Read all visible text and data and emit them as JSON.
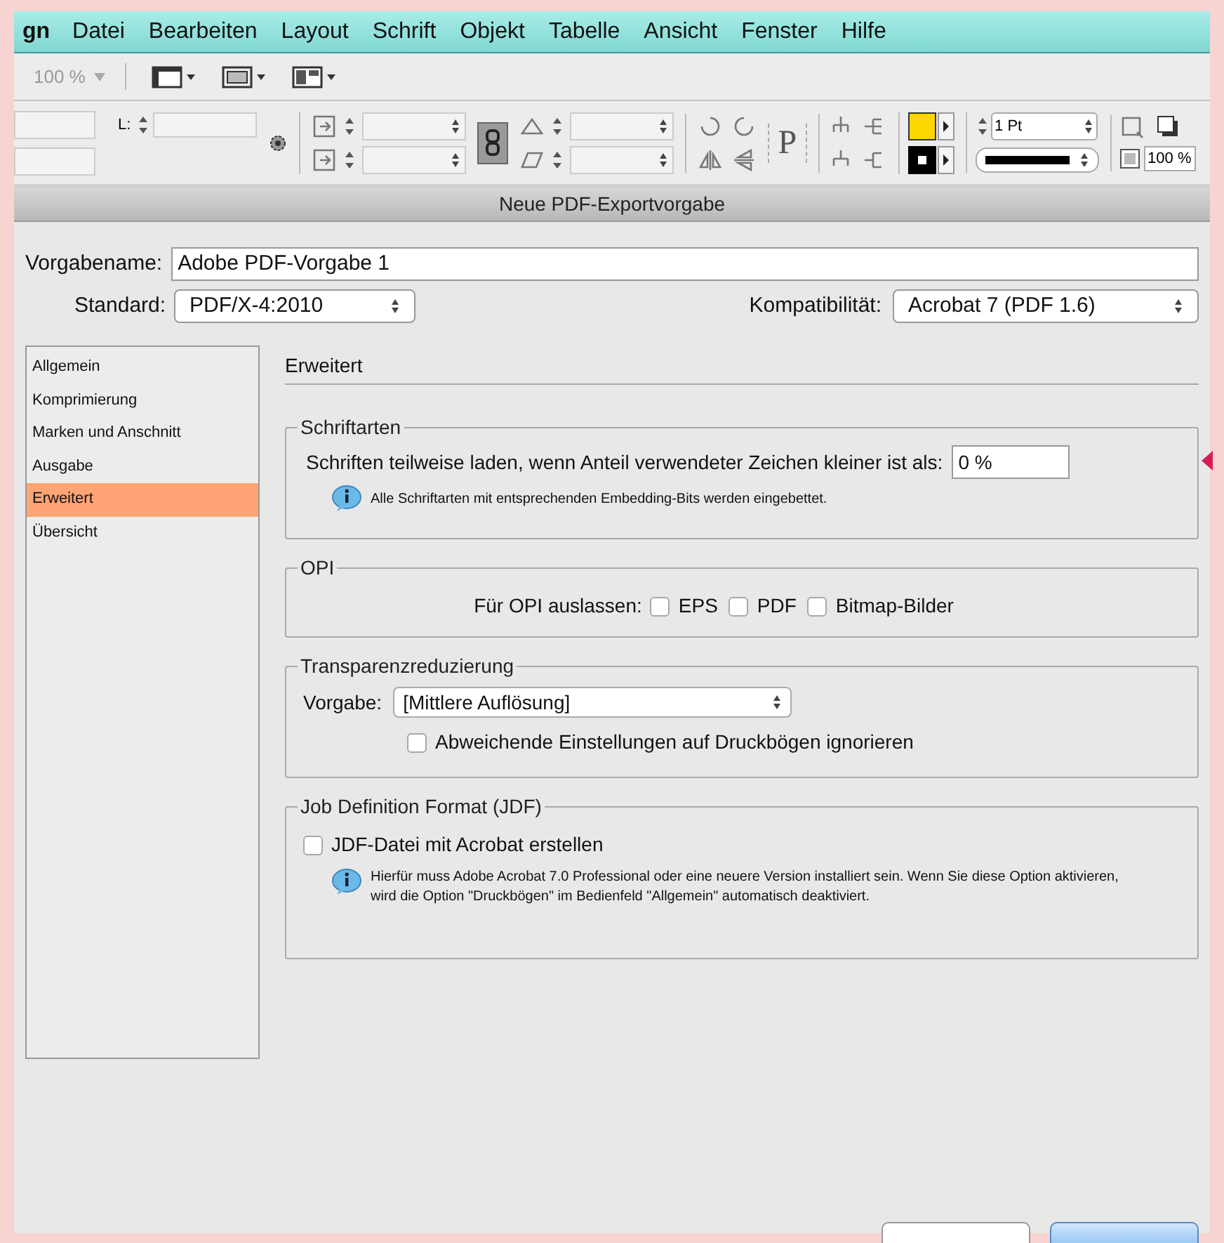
{
  "menu_bar": {
    "app_fragment": "gn",
    "items": [
      "Datei",
      "Bearbeiten",
      "Layout",
      "Schrift",
      "Objekt",
      "Tabelle",
      "Ansicht",
      "Fenster",
      "Hilfe"
    ]
  },
  "toolbar": {
    "zoom": "100 %"
  },
  "control_panel": {
    "l_label": "L:",
    "text_frame_glyph": "P",
    "stroke_weight": "1 Pt",
    "scale": "100 %"
  },
  "dialog": {
    "title": "Neue PDF-Exportvorgabe",
    "preset_name": {
      "label": "Vorgabename:",
      "value": "Adobe PDF-Vorgabe 1"
    },
    "standard": {
      "label": "Standard:",
      "value": "PDF/X-4:2010"
    },
    "compatibility": {
      "label": "Kompatibilität:",
      "value": "Acrobat 7 (PDF 1.6)"
    },
    "sidebar": {
      "items": [
        {
          "label": "Allgemein",
          "selected": false
        },
        {
          "label": "Komprimierung",
          "selected": false
        },
        {
          "label": "Marken und Anschnitt",
          "selected": false
        },
        {
          "label": "Ausgabe",
          "selected": false
        },
        {
          "label": "Erweitert",
          "selected": true
        },
        {
          "label": "Übersicht",
          "selected": false
        }
      ]
    },
    "section_title": "Erweitert",
    "fonts": {
      "title": "Schriftarten",
      "label": "Schriften teilweise laden, wenn Anteil verwendeter Zeichen kleiner ist als:",
      "value": "0 %",
      "info": "Alle Schriftarten mit entsprechenden Embedding-Bits werden eingebettet."
    },
    "opi": {
      "title": "OPI",
      "label": "Für OPI auslassen:",
      "options": [
        {
          "label": "EPS",
          "checked": false
        },
        {
          "label": "PDF",
          "checked": false
        },
        {
          "label": "Bitmap-Bilder",
          "checked": false
        }
      ]
    },
    "transparency": {
      "title": "Transparenzreduzierung",
      "preset_label": "Vorgabe:",
      "preset_value": "[Mittlere Auflösung]",
      "checkbox": {
        "label": "Abweichende Einstellungen auf Druckbögen ignorieren",
        "checked": false
      }
    },
    "jdf": {
      "title": "Job Definition Format (JDF)",
      "checkbox": {
        "label": "JDF-Datei mit Acrobat erstellen",
        "checked": false
      },
      "info": "Hierfür muss Adobe Acrobat 7.0 Professional oder eine neuere Version installiert sein. Wenn Sie diese Option aktivieren, wird die Option \"Druckbögen\" im Bedienfeld \"Allgemein\" automatisch deaktiviert."
    },
    "buttons": [
      {
        "kind": "cancel"
      },
      {
        "kind": "default"
      }
    ]
  }
}
